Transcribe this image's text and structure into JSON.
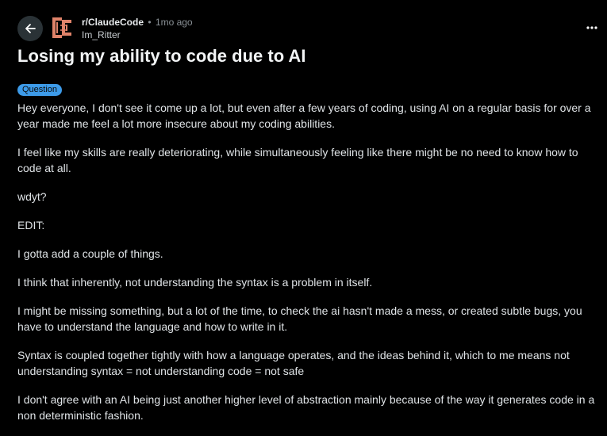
{
  "post": {
    "subreddit": "r/ClaudeCode",
    "separator": "•",
    "time_ago": "1mo ago",
    "author": "Im_Ritter",
    "title": "Losing my ability to code due to AI",
    "flair": "Question",
    "body": [
      "Hey everyone, I don't see it come up a lot, but even after a few years of coding, using AI on a regular basis for over a year made me feel a lot more insecure about my coding abilities.",
      "I feel like my skills are really deteriorating, while simultaneously feeling like there might be no need to know how to code at all.",
      "wdyt?",
      "EDIT:",
      "I gotta add a couple of things.",
      "I think that inherently, not understanding the syntax is a problem in itself.",
      "I might be missing something, but a lot of the time, to check the ai hasn't made a mess, or created subtle bugs, you have to understand the language and how to write in it.",
      "Syntax is coupled together tightly with how a language operates, and the ideas behind it, which to me means not understanding syntax = not understanding code = not safe",
      "I don't agree with an AI being just another higher level of abstraction mainly because of the way it generates code in a non deterministic fashion."
    ]
  },
  "icons": {
    "back": "arrow-left-icon",
    "subreddit": "claudecode-subreddit-icon",
    "more": "more-options-icon"
  },
  "colors": {
    "background": "#000000",
    "flair": "#3d9be9",
    "subreddit_icon": "#e0836a",
    "back_button_bg": "#2a3236"
  }
}
